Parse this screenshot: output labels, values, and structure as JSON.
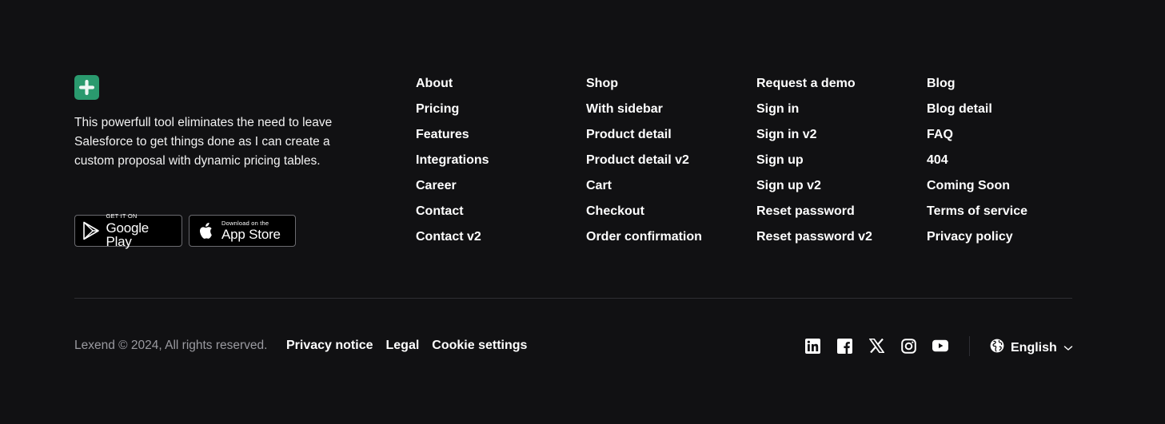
{
  "brand": {
    "logo_icon": "plus-logo-icon",
    "logo_color": "#2a9a6e",
    "tagline": "This powerfull tool eliminates the need to leave Salesforce to get things done as I can create a custom proposal with dynamic pricing tables."
  },
  "stores": {
    "google_play": {
      "small": "GET IT ON",
      "big": "Google Play",
      "icon": "google-play-icon"
    },
    "app_store": {
      "small": "Download on the",
      "big": "App Store",
      "icon": "apple-icon"
    }
  },
  "columns": [
    [
      "About",
      "Pricing",
      "Features",
      "Integrations",
      "Career",
      "Contact",
      "Contact v2"
    ],
    [
      "Shop",
      "With sidebar",
      "Product detail",
      "Product detail v2",
      "Cart",
      "Checkout",
      "Order confirmation"
    ],
    [
      "Request a demo",
      "Sign in",
      "Sign in v2",
      "Sign up",
      "Sign up v2",
      "Reset password",
      "Reset password v2"
    ],
    [
      "Blog",
      "Blog detail",
      "FAQ",
      "404",
      "Coming Soon",
      "Terms of service",
      "Privacy policy"
    ]
  ],
  "footer": {
    "copyright": "Lexend © 2024, All rights reserved.",
    "links": [
      "Privacy notice",
      "Legal",
      "Cookie settings"
    ],
    "social": [
      "linkedin-icon",
      "facebook-icon",
      "x-icon",
      "instagram-icon",
      "youtube-icon"
    ],
    "language": {
      "label": "English",
      "icon": "globe-icon",
      "chevron": "chevron-down-icon"
    }
  },
  "colors": {
    "background": "#111113",
    "text": "#ffffff",
    "muted": "#9a9aa0",
    "divider": "#2e2e33"
  }
}
